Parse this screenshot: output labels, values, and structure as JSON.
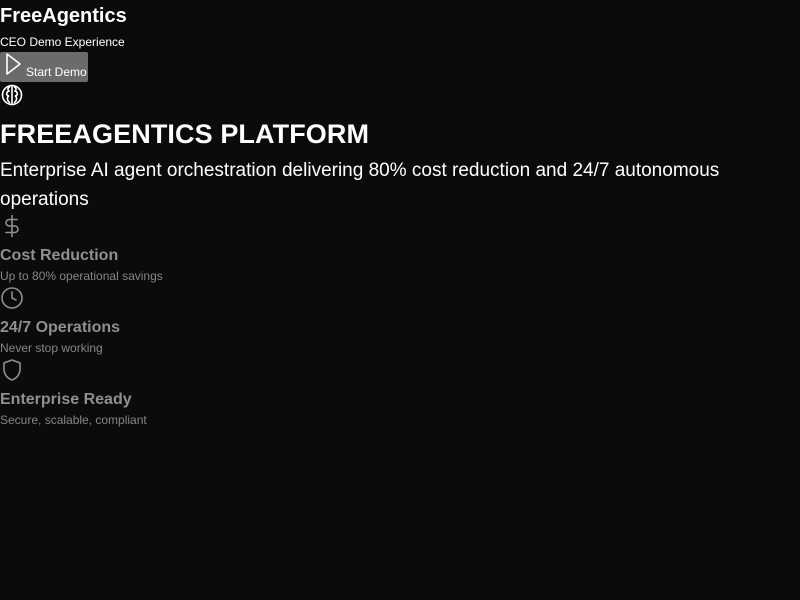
{
  "header": {
    "brand": "FreeAgentics",
    "subtitle": "CEO Demo Experience",
    "start_button_label": "Start Demo"
  },
  "hero": {
    "title": "FREEAGENTICS PLATFORM",
    "subtitle": "Enterprise AI agent orchestration delivering 80% cost reduction and 24/7 autonomous operations"
  },
  "features": [
    {
      "icon": "dollar-icon",
      "title": "Cost Reduction",
      "description": "Up to 80% operational savings"
    },
    {
      "icon": "clock-icon",
      "title": "24/7 Operations",
      "description": "Never stop working"
    },
    {
      "icon": "shield-icon",
      "title": "Enterprise Ready",
      "description": "Secure, scalable, compliant"
    }
  ],
  "colors": {
    "background": "#0b0b0c",
    "text": "#ffffff",
    "muted": "#8f8f93",
    "button": "#6b6b6d"
  }
}
